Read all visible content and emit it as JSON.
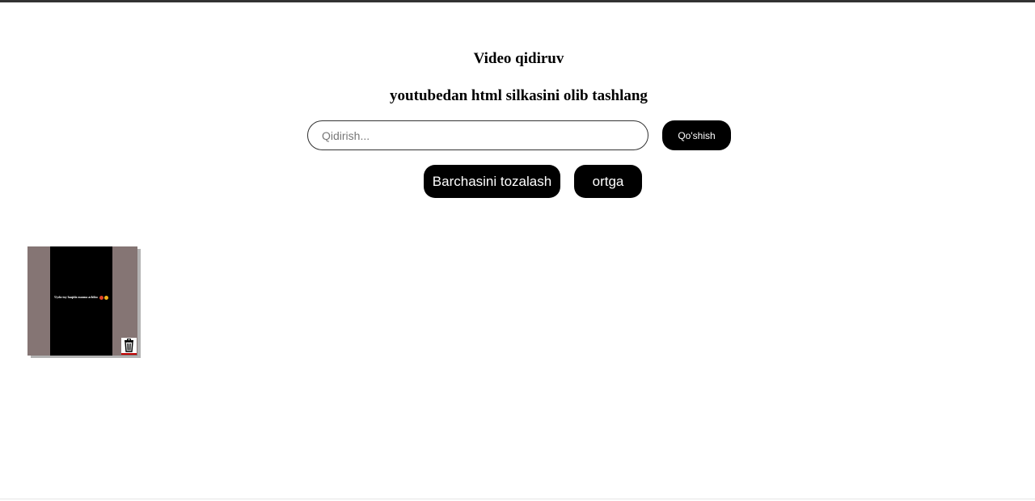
{
  "header": {
    "title": "Video qidiruv",
    "subtitle": "youtubedan html silkasini olib tashlang"
  },
  "search": {
    "placeholder": "Qidirish...",
    "value": "",
    "add_label": "Qo'shish"
  },
  "actions": {
    "clear_all_label": "Barchasini tozalash",
    "back_label": "ortga"
  },
  "videos": [
    {
      "caption": "Uyda toy haqida manna achiku",
      "emojis": [
        "red-face-emoji",
        "yellow-face-emoji"
      ],
      "delete_icon": "trash-icon"
    }
  ],
  "colors": {
    "button_bg": "#000000",
    "button_text": "#ffffff",
    "card_bg": "#857574",
    "delete_accent": "#c00000"
  }
}
